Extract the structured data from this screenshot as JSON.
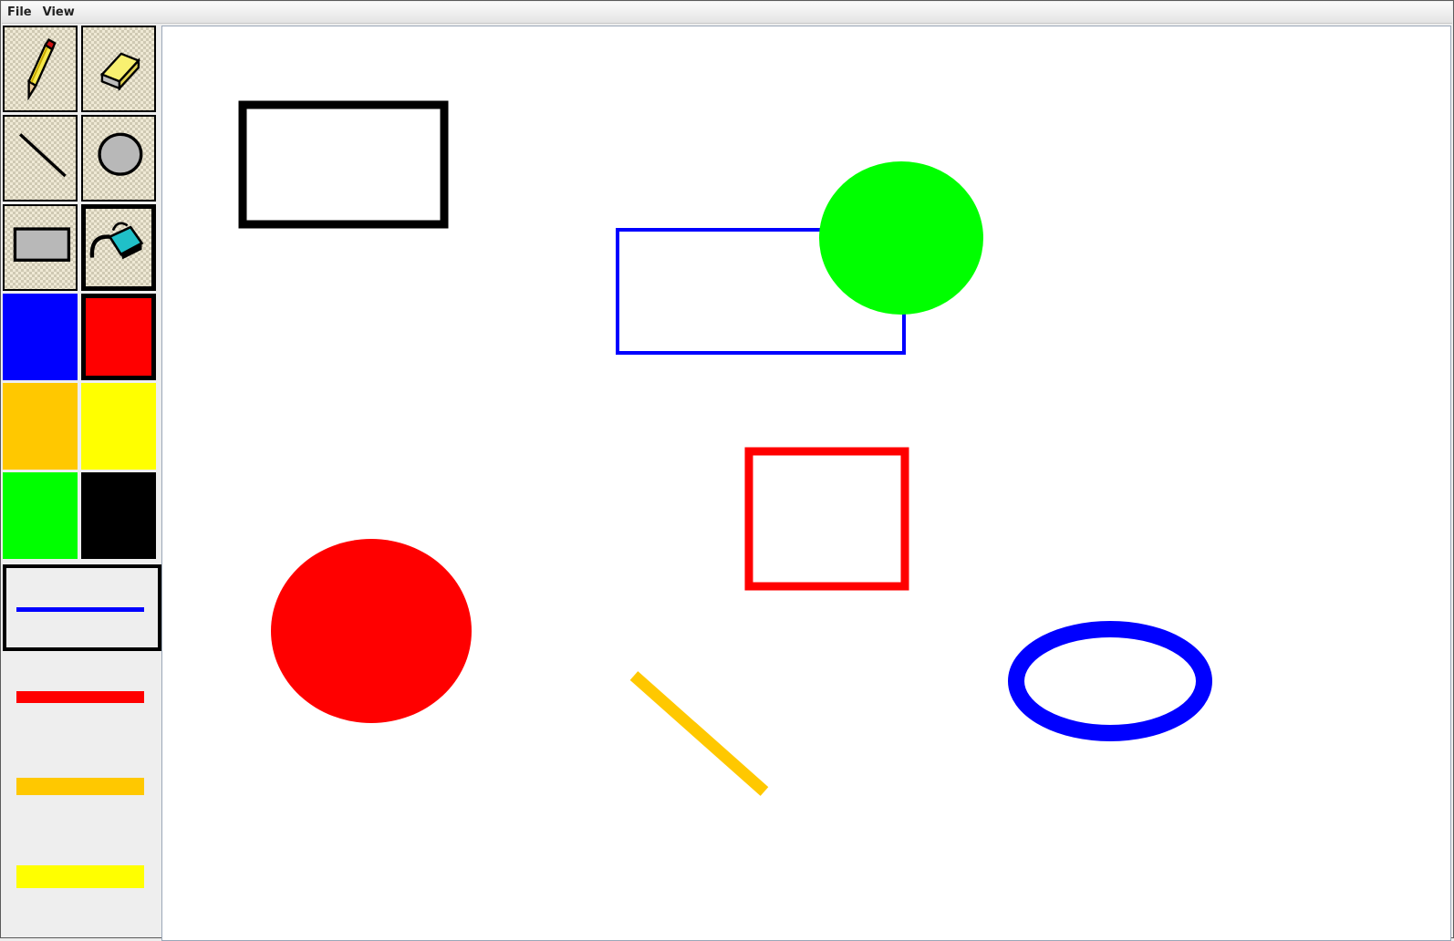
{
  "menubar": {
    "items": [
      {
        "label": "File"
      },
      {
        "label": "View"
      }
    ]
  },
  "tools": [
    {
      "name": "pencil",
      "icon": "pencil-icon",
      "selected": false
    },
    {
      "name": "eraser",
      "icon": "eraser-icon",
      "selected": false
    },
    {
      "name": "line",
      "icon": "line-icon",
      "selected": false
    },
    {
      "name": "ellipse",
      "icon": "ellipse-icon",
      "selected": false
    },
    {
      "name": "rectangle",
      "icon": "rectangle-icon",
      "selected": false
    },
    {
      "name": "fill",
      "icon": "paint-bucket-icon",
      "selected": true
    }
  ],
  "palette": [
    {
      "name": "blue",
      "color": "#0000ff",
      "selected": false
    },
    {
      "name": "red",
      "color": "#ff0000",
      "selected": true
    },
    {
      "name": "orange",
      "color": "#ffc800",
      "selected": false
    },
    {
      "name": "yellow",
      "color": "#ffff00",
      "selected": false
    },
    {
      "name": "green",
      "color": "#00ff00",
      "selected": false
    },
    {
      "name": "black",
      "color": "#000000",
      "selected": false
    }
  ],
  "stroke_widths": [
    {
      "color": "#0000ff",
      "width": 4,
      "selected": true
    },
    {
      "color": "#ff0000",
      "width": 12,
      "selected": false
    },
    {
      "color": "#ffc800",
      "width": 18,
      "selected": false
    },
    {
      "color": "#ffff00",
      "width": 24,
      "selected": false
    }
  ],
  "canvas": {
    "background": "#ffffff",
    "shapes": [
      {
        "type": "rectangle",
        "stroke": "#000000",
        "fill": "none",
        "name": "black-outline-rectangle"
      },
      {
        "type": "rectangle",
        "stroke": "#0000ff",
        "fill": "none",
        "name": "blue-outline-rectangle"
      },
      {
        "type": "ellipse",
        "stroke": "none",
        "fill": "#00ff00",
        "name": "green-filled-circle"
      },
      {
        "type": "rectangle",
        "stroke": "#ff0000",
        "fill": "none",
        "name": "red-outline-rectangle"
      },
      {
        "type": "ellipse",
        "stroke": "none",
        "fill": "#ff0000",
        "name": "red-filled-circle"
      },
      {
        "type": "line",
        "stroke": "#ffc800",
        "fill": "none",
        "name": "orange-line"
      },
      {
        "type": "ellipse",
        "stroke": "#0000ff",
        "fill": "none",
        "name": "blue-outline-ellipse"
      }
    ]
  }
}
